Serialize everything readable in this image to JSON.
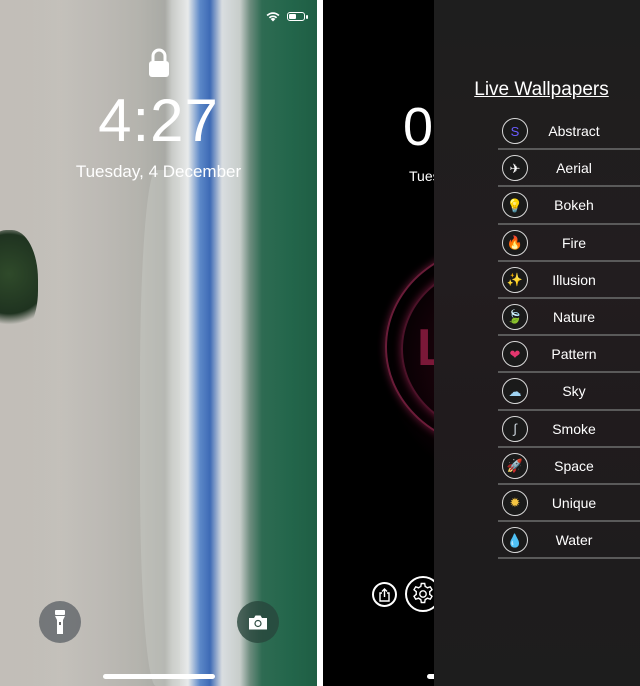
{
  "left_screen": {
    "status": {
      "wifi_icon": "wifi-icon",
      "battery_level": 0.5
    },
    "lock_icon": "lock-icon",
    "time": "4:27",
    "date": "Tuesday, 4 December",
    "quick_actions": [
      {
        "name": "flashlight",
        "icon": "flashlight-icon"
      },
      {
        "name": "camera",
        "icon": "camera-icon"
      }
    ]
  },
  "right_screen": {
    "clock_partial": "0",
    "date_partial": "Tues",
    "logo_partial": "L",
    "buttons": [
      {
        "name": "share",
        "icon": "share-icon"
      },
      {
        "name": "settings",
        "icon": "gear-icon"
      }
    ],
    "menu": {
      "title": "Live Wallpapers",
      "items": [
        {
          "label": "Abstract",
          "icon": "abstract-icon",
          "glyph": "S",
          "color": "#6a5cff"
        },
        {
          "label": "Aerial",
          "icon": "airplane-icon",
          "glyph": "✈",
          "color": "#ffffff"
        },
        {
          "label": "Bokeh",
          "icon": "bokeh-lights-icon",
          "glyph": "💡",
          "color": "#f2c94c"
        },
        {
          "label": "Fire",
          "icon": "fire-icon",
          "glyph": "🔥",
          "color": "#f2a62b"
        },
        {
          "label": "Illusion",
          "icon": "sparkles-icon",
          "glyph": "✨",
          "color": "#f5c542"
        },
        {
          "label": "Nature",
          "icon": "leaf-icon",
          "glyph": "🍃",
          "color": "#4caf50"
        },
        {
          "label": "Pattern",
          "icon": "pattern-icon",
          "glyph": "❤",
          "color": "#e4366e"
        },
        {
          "label": "Sky",
          "icon": "cloud-icon",
          "glyph": "☁",
          "color": "#9fd3f2"
        },
        {
          "label": "Smoke",
          "icon": "smoke-icon",
          "glyph": "∫",
          "color": "#cfd8e0"
        },
        {
          "label": "Space",
          "icon": "rocket-icon",
          "glyph": "🚀",
          "color": "#e05050"
        },
        {
          "label": "Unique",
          "icon": "sun-icon",
          "glyph": "✹",
          "color": "#f5c542"
        },
        {
          "label": "Water",
          "icon": "water-drops-icon",
          "glyph": "💧",
          "color": "#3aa0e8"
        }
      ]
    }
  }
}
